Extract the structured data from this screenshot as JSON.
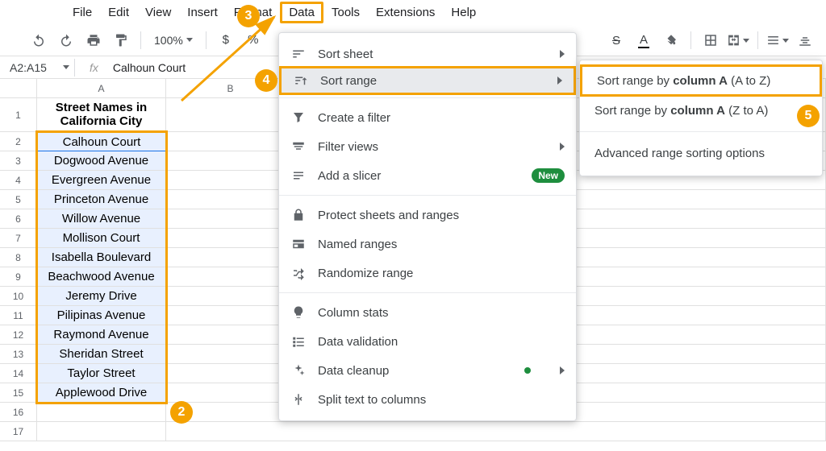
{
  "menubar": {
    "items": [
      "File",
      "Edit",
      "View",
      "Insert",
      "Format",
      "Data",
      "Tools",
      "Extensions",
      "Help"
    ],
    "highlight_index": 5
  },
  "toolbar": {
    "zoom": "100%",
    "currency": "$",
    "percent": "%"
  },
  "formula_bar": {
    "name_box": "A2:A15",
    "fx_label": "fx",
    "value": "Calhoun Court"
  },
  "grid": {
    "columns": [
      "A",
      "B"
    ],
    "header_text": "Street Names in California City",
    "data": [
      "Calhoun Court",
      "Dogwood Avenue",
      "Evergreen Avenue",
      "Princeton Avenue",
      "Willow Avenue",
      "Mollison Court",
      "Isabella Boulevard",
      "Beachwood Avenue",
      "Jeremy Drive",
      "Pilipinas Avenue",
      "Raymond Avenue",
      "Sheridan Street",
      "Taylor Street",
      "Applewood Drive"
    ]
  },
  "menu_data": {
    "sort_sheet": "Sort sheet",
    "sort_range": "Sort range",
    "create_filter": "Create a filter",
    "filter_views": "Filter views",
    "add_slicer": "Add a slicer",
    "new_badge": "New",
    "protect": "Protect sheets and ranges",
    "named_ranges": "Named ranges",
    "randomize": "Randomize range",
    "column_stats": "Column stats",
    "data_validation": "Data validation",
    "data_cleanup": "Data cleanup",
    "split_text": "Split text to columns"
  },
  "submenu": {
    "az_prefix": "Sort range by ",
    "az_bold": "column A",
    "az_suffix": " (A to Z)",
    "za_prefix": "Sort range by ",
    "za_bold": "column A",
    "za_suffix": " (Z to A)",
    "advanced": "Advanced range sorting options"
  },
  "annotations": {
    "b2": "2",
    "b3": "3",
    "b4": "4",
    "b5": "5"
  }
}
